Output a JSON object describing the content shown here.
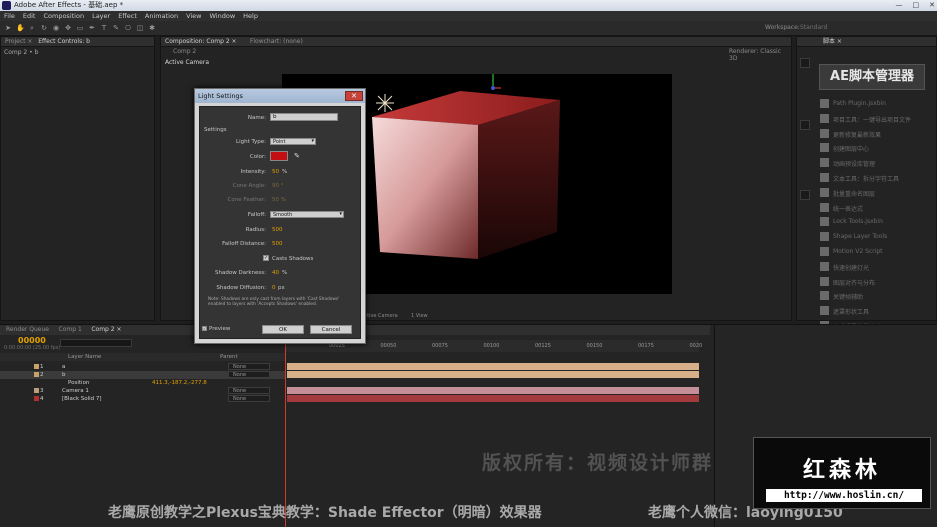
{
  "window": {
    "title": "Adobe After Effects - 基础.aep *",
    "controls": [
      "—",
      "□",
      "✕"
    ]
  },
  "menu": [
    "File",
    "Edit",
    "Composition",
    "Layer",
    "Effect",
    "Animation",
    "View",
    "Window",
    "Help"
  ],
  "toolbar": {
    "workspace_label": "Workspace:",
    "workspace_value": "Standard"
  },
  "project_panel": {
    "tab_project": "Project ×",
    "tab_effect": "Effect Controls: b",
    "subtitle": "Comp 2 • b"
  },
  "comp_panel": {
    "tab": "Composition: Comp 2 ×",
    "tab2": "Flowchart: (none)",
    "subtab": "Comp 2",
    "renderer": "Renderer:  Classic 3D",
    "view_label": "Active Camera",
    "view_menu": "Active Camera",
    "view_count": "1 View"
  },
  "right_panel": {
    "tab": "脚本 ×",
    "header": "AE脚本管理器",
    "items": [
      "Path Plugin.jsxbin",
      "项目工具：一键导出项目文件",
      "更新修复最新效果",
      "创建图层中心",
      "动画预设库管理",
      "文本工具：拆分字符工具",
      "批量重命名图层",
      "统一表达式",
      "Lock Tools.jsxbin",
      "Shape Layer Tools",
      "Motion V2 Script",
      "快速创建灯光",
      "图层对齐与分布",
      "关键帧辅助",
      "遮罩形状工具",
      "合成设置批量修改"
    ]
  },
  "dialog": {
    "title": "Light Settings",
    "close": "✕",
    "name_label": "Name:",
    "name_value": "b",
    "section": "Settings",
    "light_type_label": "Light Type:",
    "light_type_value": "Point",
    "color_label": "Color:",
    "color_hex": "#c30f12",
    "intensity_label": "Intensity:",
    "intensity_value": "50",
    "intensity_unit": "%",
    "cone_angle_label": "Cone Angle:",
    "cone_angle_value": "90 °",
    "cone_feather_label": "Cone Feather:",
    "cone_feather_value": "50 %",
    "falloff_label": "Falloff:",
    "falloff_value": "Smooth",
    "radius_label": "Radius:",
    "radius_value": "500",
    "falloff_distance_label": "Falloff Distance:",
    "falloff_distance_value": "500",
    "casts_shadows": "Casts Shadows",
    "shadow_darkness_label": "Shadow Darkness:",
    "shadow_darkness_value": "40",
    "shadow_darkness_unit": "%",
    "shadow_diffusion_label": "Shadow Diffusion:",
    "shadow_diffusion_value": "0",
    "shadow_diffusion_unit": "px",
    "note": "Note: Shadows are only cast from layers with 'Cast Shadows' enabled to layers with 'Accepts Shadows' enabled.",
    "preview": "Preview",
    "ok": "OK",
    "cancel": "Cancel"
  },
  "timeline": {
    "tab1": "Render Queue",
    "tab2": "Comp 1",
    "tab3": "Comp 2 ×",
    "timecode": "00000",
    "fps": "0:00:00:00 (25.00 fps)",
    "col_layer_name": "Layer Name",
    "col_parent": "Parent",
    "ruler": [
      "00025",
      "00050",
      "00075",
      "00100",
      "00125",
      "00150",
      "00175",
      "0020"
    ],
    "layers": [
      {
        "num": "1",
        "name": "a",
        "parent": "None",
        "swatch": "#c9a26a"
      },
      {
        "num": "2",
        "name": "b",
        "parent": "None",
        "swatch": "#c9a26a"
      },
      {
        "num": "3",
        "name": "Camera 1",
        "parent": "None",
        "swatch": "#b9a07a"
      },
      {
        "num": "4",
        "name": "[Black Solid 7]",
        "parent": "None",
        "swatch": "#b03030"
      }
    ],
    "position_label": "Position",
    "position_value": "411.3,-187.2,-277.8"
  },
  "overlay": {
    "watermark": "版权所有：视频设计师群",
    "subtitle": "老鹰原创教学之Plexus宝典教学：Shade Effector（明暗）效果器",
    "subtitle2": "老鹰个人微信：laoying0150",
    "logo": "红森林",
    "logo_url": "http://www.hoslin.cn/"
  },
  "colors": {
    "accent": "#e3a200",
    "bar_tan": "#d7b08a",
    "bar_pink": "#c48f98",
    "bar_red": "#a33a3e",
    "light_red": "#c30f12"
  }
}
